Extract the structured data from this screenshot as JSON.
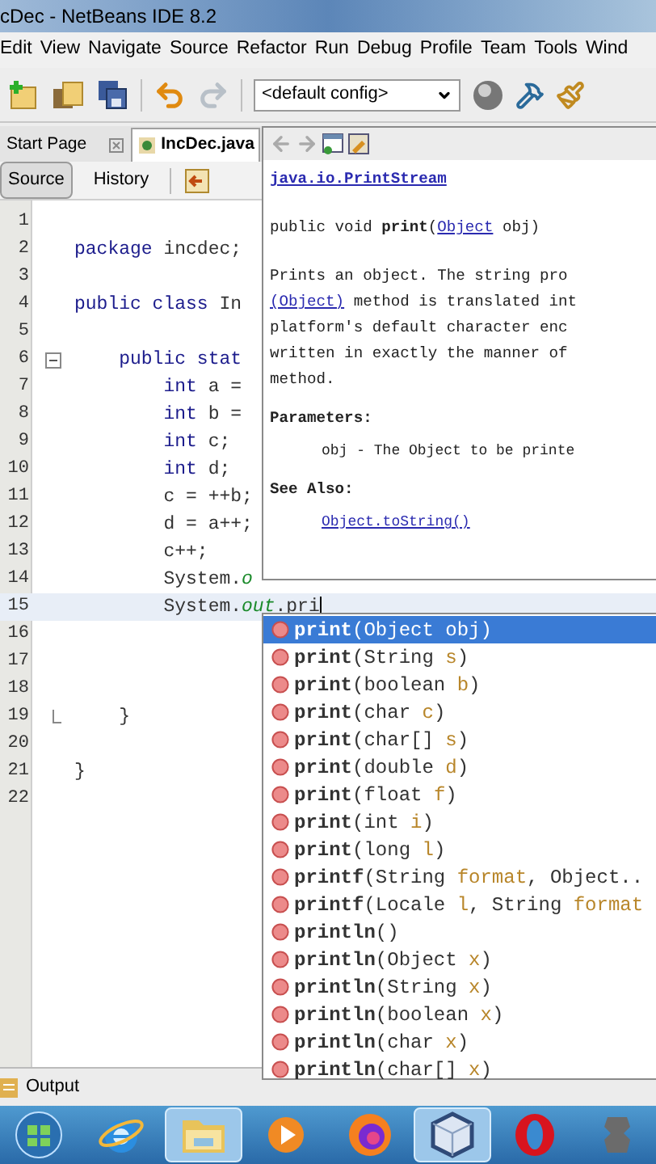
{
  "window": {
    "title": "cDec - NetBeans IDE 8.2"
  },
  "menu": [
    "Edit",
    "View",
    "Navigate",
    "Source",
    "Refactor",
    "Run",
    "Debug",
    "Profile",
    "Team",
    "Tools",
    "Wind"
  ],
  "toolbar": {
    "config": "<default config>"
  },
  "tabs": [
    {
      "label": "Start Page",
      "selected": false
    },
    {
      "label": "IncDec.java",
      "selected": true
    }
  ],
  "editor_views": [
    {
      "label": "Source",
      "selected": true
    },
    {
      "label": "History",
      "selected": false
    }
  ],
  "code_lines": [
    {
      "number": "1",
      "current": false
    },
    {
      "number": "2",
      "current": false,
      "tokens": [
        {
          "text": "package",
          "kind": "kw"
        },
        {
          "text": " incdec;",
          "kind": "plain"
        }
      ]
    },
    {
      "number": "3",
      "current": false
    },
    {
      "number": "4",
      "current": false,
      "tokens": [
        {
          "text": "public class",
          "kind": "kw"
        },
        {
          "text": " In",
          "kind": "plain"
        }
      ]
    },
    {
      "number": "5",
      "current": false
    },
    {
      "number": "6",
      "current": false,
      "fold_open": true,
      "tokens": [
        {
          "text": "    public stat",
          "kind": "kw"
        }
      ]
    },
    {
      "number": "7",
      "current": false,
      "tokens": [
        {
          "text": "        int",
          "kind": "kw"
        },
        {
          "text": " a =",
          "kind": "plain"
        }
      ]
    },
    {
      "number": "8",
      "current": false,
      "tokens": [
        {
          "text": "        int",
          "kind": "kw"
        },
        {
          "text": " b =",
          "kind": "plain"
        }
      ]
    },
    {
      "number": "9",
      "current": false,
      "tokens": [
        {
          "text": "        int",
          "kind": "kw"
        },
        {
          "text": " c;",
          "kind": "plain"
        }
      ]
    },
    {
      "number": "10",
      "current": false,
      "tokens": [
        {
          "text": "        int",
          "kind": "kw"
        },
        {
          "text": " d;",
          "kind": "plain"
        }
      ]
    },
    {
      "number": "11",
      "current": false,
      "tokens": [
        {
          "text": "        c = ++b;",
          "kind": "plain"
        }
      ]
    },
    {
      "number": "12",
      "current": false,
      "tokens": [
        {
          "text": "        d = a++;",
          "kind": "plain"
        }
      ]
    },
    {
      "number": "13",
      "current": false,
      "tokens": [
        {
          "text": "        c++;",
          "kind": "plain"
        }
      ]
    },
    {
      "number": "14",
      "current": false,
      "tokens": [
        {
          "text": "        System.",
          "kind": "plain"
        },
        {
          "text": "o",
          "kind": "field"
        }
      ]
    },
    {
      "number": "15",
      "current": true,
      "tokens": [
        {
          "text": "        System.",
          "kind": "plain"
        },
        {
          "text": "out",
          "kind": "field"
        },
        {
          "text": ".pri",
          "kind": "plain"
        }
      ]
    },
    {
      "number": "16",
      "current": false
    },
    {
      "number": "17",
      "current": false
    },
    {
      "number": "18",
      "current": false
    },
    {
      "number": "19",
      "current": false,
      "fold_close": true,
      "tokens": [
        {
          "text": "    }",
          "kind": "plain"
        }
      ]
    },
    {
      "number": "20",
      "current": false
    },
    {
      "number": "21",
      "current": false,
      "tokens": [
        {
          "text": "}",
          "kind": "plain"
        }
      ]
    },
    {
      "number": "22",
      "current": false
    }
  ],
  "doc": {
    "class_link": "java.io.PrintStream",
    "signature": [
      {
        "text": "public void ",
        "kind": "plain"
      },
      {
        "text": "print",
        "kind": "bold"
      },
      {
        "text": "(",
        "kind": "plain"
      },
      {
        "text": "Object",
        "kind": "link"
      },
      {
        "text": " obj)",
        "kind": "plain"
      }
    ],
    "description": [
      [
        {
          "text": "Prints an object. The string pro",
          "kind": "plain"
        }
      ],
      [
        {
          "text": "(Object)",
          "kind": "link"
        },
        {
          "text": " method is translated int",
          "kind": "plain"
        }
      ],
      [
        {
          "text": "platform's default character enc",
          "kind": "plain"
        }
      ],
      [
        {
          "text": "written in exactly the manner of",
          "kind": "plain"
        }
      ],
      [
        {
          "text": "method.",
          "kind": "plain"
        }
      ]
    ],
    "sections": [
      {
        "heading": "Parameters:",
        "body": {
          "text": "obj - The Object to be printe",
          "kind": "plain"
        }
      },
      {
        "heading": "See Also:",
        "body": {
          "text": "Object.toString()",
          "kind": "link"
        }
      }
    ]
  },
  "completions": [
    {
      "selected": true,
      "parts": [
        {
          "text": "print",
          "kind": "method"
        },
        {
          "text": "(Object ",
          "kind": "type"
        },
        {
          "text": "obj",
          "kind": "param"
        },
        {
          "text": ")",
          "kind": "type"
        }
      ]
    },
    {
      "selected": false,
      "parts": [
        {
          "text": "print",
          "kind": "method"
        },
        {
          "text": "(String ",
          "kind": "type"
        },
        {
          "text": "s",
          "kind": "param"
        },
        {
          "text": ")",
          "kind": "type"
        }
      ]
    },
    {
      "selected": false,
      "parts": [
        {
          "text": "print",
          "kind": "method"
        },
        {
          "text": "(boolean ",
          "kind": "type"
        },
        {
          "text": "b",
          "kind": "param"
        },
        {
          "text": ")",
          "kind": "type"
        }
      ]
    },
    {
      "selected": false,
      "parts": [
        {
          "text": "print",
          "kind": "method"
        },
        {
          "text": "(char ",
          "kind": "type"
        },
        {
          "text": "c",
          "kind": "param"
        },
        {
          "text": ")",
          "kind": "type"
        }
      ]
    },
    {
      "selected": false,
      "parts": [
        {
          "text": "print",
          "kind": "method"
        },
        {
          "text": "(char[] ",
          "kind": "type"
        },
        {
          "text": "s",
          "kind": "param"
        },
        {
          "text": ")",
          "kind": "type"
        }
      ]
    },
    {
      "selected": false,
      "parts": [
        {
          "text": "print",
          "kind": "method"
        },
        {
          "text": "(double ",
          "kind": "type"
        },
        {
          "text": "d",
          "kind": "param"
        },
        {
          "text": ")",
          "kind": "type"
        }
      ]
    },
    {
      "selected": false,
      "parts": [
        {
          "text": "print",
          "kind": "method"
        },
        {
          "text": "(float ",
          "kind": "type"
        },
        {
          "text": "f",
          "kind": "param"
        },
        {
          "text": ")",
          "kind": "type"
        }
      ]
    },
    {
      "selected": false,
      "parts": [
        {
          "text": "print",
          "kind": "method"
        },
        {
          "text": "(int ",
          "kind": "type"
        },
        {
          "text": "i",
          "kind": "param"
        },
        {
          "text": ")",
          "kind": "type"
        }
      ]
    },
    {
      "selected": false,
      "parts": [
        {
          "text": "print",
          "kind": "method"
        },
        {
          "text": "(long ",
          "kind": "type"
        },
        {
          "text": "l",
          "kind": "param"
        },
        {
          "text": ")",
          "kind": "type"
        }
      ]
    },
    {
      "selected": false,
      "parts": [
        {
          "text": "printf",
          "kind": "method"
        },
        {
          "text": "(String ",
          "kind": "type"
        },
        {
          "text": "format",
          "kind": "param"
        },
        {
          "text": ", Object..",
          "kind": "type"
        }
      ]
    },
    {
      "selected": false,
      "parts": [
        {
          "text": "printf",
          "kind": "method"
        },
        {
          "text": "(Locale ",
          "kind": "type"
        },
        {
          "text": "l",
          "kind": "param"
        },
        {
          "text": ", String ",
          "kind": "type"
        },
        {
          "text": "format",
          "kind": "param"
        }
      ]
    },
    {
      "selected": false,
      "parts": [
        {
          "text": "println",
          "kind": "method"
        },
        {
          "text": "()",
          "kind": "type"
        }
      ]
    },
    {
      "selected": false,
      "parts": [
        {
          "text": "println",
          "kind": "method"
        },
        {
          "text": "(Object ",
          "kind": "type"
        },
        {
          "text": "x",
          "kind": "param"
        },
        {
          "text": ")",
          "kind": "type"
        }
      ]
    },
    {
      "selected": false,
      "parts": [
        {
          "text": "println",
          "kind": "method"
        },
        {
          "text": "(String ",
          "kind": "type"
        },
        {
          "text": "x",
          "kind": "param"
        },
        {
          "text": ")",
          "kind": "type"
        }
      ]
    },
    {
      "selected": false,
      "parts": [
        {
          "text": "println",
          "kind": "method"
        },
        {
          "text": "(boolean ",
          "kind": "type"
        },
        {
          "text": "x",
          "kind": "param"
        },
        {
          "text": ")",
          "kind": "type"
        }
      ]
    },
    {
      "selected": false,
      "parts": [
        {
          "text": "println",
          "kind": "method"
        },
        {
          "text": "(char ",
          "kind": "type"
        },
        {
          "text": "x",
          "kind": "param"
        },
        {
          "text": ")",
          "kind": "type"
        }
      ]
    },
    {
      "selected": false,
      "parts": [
        {
          "text": "println",
          "kind": "method"
        },
        {
          "text": "(char[] ",
          "kind": "type"
        },
        {
          "text": "x",
          "kind": "param"
        },
        {
          "text": ")",
          "kind": "type"
        }
      ]
    }
  ],
  "bottom_panel": {
    "label": "Output"
  }
}
